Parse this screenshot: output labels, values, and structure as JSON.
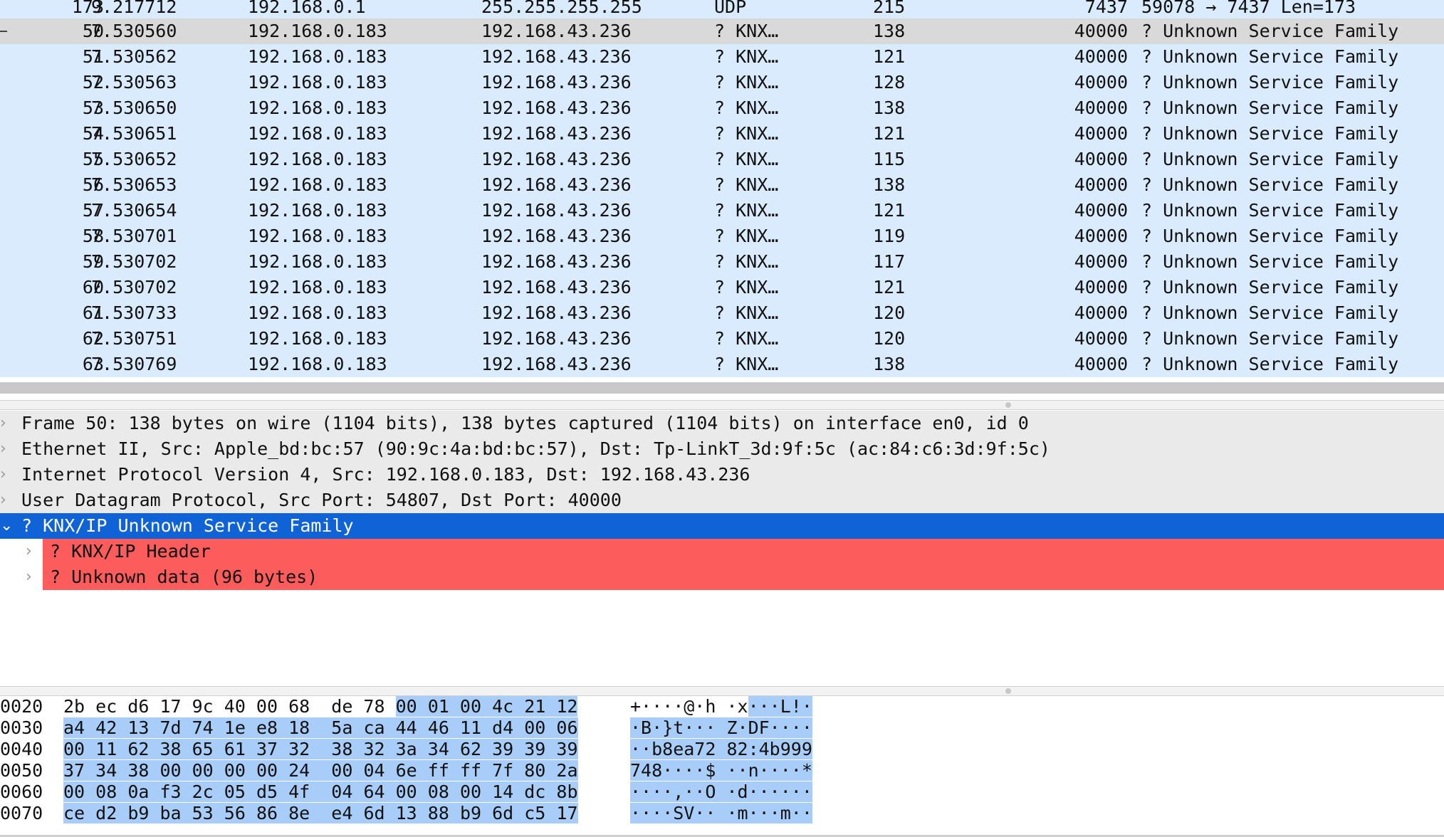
{
  "packets": [
    {
      "no": "173",
      "time": "9.217712",
      "src": "192.168.0.1",
      "dst": "255.255.255.255",
      "proto": "UDP",
      "len": "215",
      "port": "7437",
      "info": "59078 → 7437 Len=173"
    },
    {
      "no": "50",
      "time": "7.530560",
      "src": "192.168.0.183",
      "dst": "192.168.43.236",
      "proto": "? KNX…",
      "len": "138",
      "port": "40000",
      "info": "? Unknown Service Family",
      "selected": true
    },
    {
      "no": "51",
      "time": "7.530562",
      "src": "192.168.0.183",
      "dst": "192.168.43.236",
      "proto": "? KNX…",
      "len": "121",
      "port": "40000",
      "info": "? Unknown Service Family"
    },
    {
      "no": "52",
      "time": "7.530563",
      "src": "192.168.0.183",
      "dst": "192.168.43.236",
      "proto": "? KNX…",
      "len": "128",
      "port": "40000",
      "info": "? Unknown Service Family"
    },
    {
      "no": "53",
      "time": "7.530650",
      "src": "192.168.0.183",
      "dst": "192.168.43.236",
      "proto": "? KNX…",
      "len": "138",
      "port": "40000",
      "info": "? Unknown Service Family"
    },
    {
      "no": "54",
      "time": "7.530651",
      "src": "192.168.0.183",
      "dst": "192.168.43.236",
      "proto": "? KNX…",
      "len": "121",
      "port": "40000",
      "info": "? Unknown Service Family"
    },
    {
      "no": "55",
      "time": "7.530652",
      "src": "192.168.0.183",
      "dst": "192.168.43.236",
      "proto": "? KNX…",
      "len": "115",
      "port": "40000",
      "info": "? Unknown Service Family"
    },
    {
      "no": "56",
      "time": "7.530653",
      "src": "192.168.0.183",
      "dst": "192.168.43.236",
      "proto": "? KNX…",
      "len": "138",
      "port": "40000",
      "info": "? Unknown Service Family"
    },
    {
      "no": "57",
      "time": "7.530654",
      "src": "192.168.0.183",
      "dst": "192.168.43.236",
      "proto": "? KNX…",
      "len": "121",
      "port": "40000",
      "info": "? Unknown Service Family"
    },
    {
      "no": "58",
      "time": "7.530701",
      "src": "192.168.0.183",
      "dst": "192.168.43.236",
      "proto": "? KNX…",
      "len": "119",
      "port": "40000",
      "info": "? Unknown Service Family"
    },
    {
      "no": "59",
      "time": "7.530702",
      "src": "192.168.0.183",
      "dst": "192.168.43.236",
      "proto": "? KNX…",
      "len": "117",
      "port": "40000",
      "info": "? Unknown Service Family"
    },
    {
      "no": "60",
      "time": "7.530702",
      "src": "192.168.0.183",
      "dst": "192.168.43.236",
      "proto": "? KNX…",
      "len": "121",
      "port": "40000",
      "info": "? Unknown Service Family"
    },
    {
      "no": "61",
      "time": "7.530733",
      "src": "192.168.0.183",
      "dst": "192.168.43.236",
      "proto": "? KNX…",
      "len": "120",
      "port": "40000",
      "info": "? Unknown Service Family"
    },
    {
      "no": "62",
      "time": "7.530751",
      "src": "192.168.0.183",
      "dst": "192.168.43.236",
      "proto": "? KNX…",
      "len": "120",
      "port": "40000",
      "info": "? Unknown Service Family"
    },
    {
      "no": "63",
      "time": "7.530769",
      "src": "192.168.0.183",
      "dst": "192.168.43.236",
      "proto": "? KNX…",
      "len": "138",
      "port": "40000",
      "info": "? Unknown Service Family"
    }
  ],
  "details": [
    {
      "text": "Frame 50: 138 bytes on wire (1104 bits), 138 bytes captured (1104 bits) on interface en0, id 0",
      "chevron": "›",
      "level": 0
    },
    {
      "text": "Ethernet II, Src: Apple_bd:bc:57 (90:9c:4a:bd:bc:57), Dst: Tp-LinkT_3d:9f:5c (ac:84:c6:3d:9f:5c)",
      "chevron": "›",
      "level": 0
    },
    {
      "text": "Internet Protocol Version 4, Src: 192.168.0.183, Dst: 192.168.43.236",
      "chevron": "›",
      "level": 0
    },
    {
      "text": "User Datagram Protocol, Src Port: 54807, Dst Port: 40000",
      "chevron": "›",
      "level": 0
    },
    {
      "text": "? KNX/IP Unknown Service Family",
      "chevron": "⌄",
      "level": 0,
      "selected": true
    },
    {
      "text": "? KNX/IP Header",
      "chevron": "›",
      "level": 1,
      "error": true
    },
    {
      "text": "? Unknown data (96 bytes)",
      "chevron": "›",
      "level": 1,
      "error": true
    }
  ],
  "hex": [
    {
      "offset": "0020",
      "bytes": [
        "2b",
        "ec",
        "d6",
        "17",
        "9c",
        "40",
        "00",
        "68",
        "de",
        "78",
        "00",
        "01",
        "00",
        "4c",
        "21",
        "12"
      ],
      "ascii": "+····@·h ·x···L!·",
      "hl_from": 10
    },
    {
      "offset": "0030",
      "bytes": [
        "a4",
        "42",
        "13",
        "7d",
        "74",
        "1e",
        "e8",
        "18",
        "5a",
        "ca",
        "44",
        "46",
        "11",
        "d4",
        "00",
        "06"
      ],
      "ascii": "·B·}t··· Z·DF····",
      "hl_from": 0
    },
    {
      "offset": "0040",
      "bytes": [
        "00",
        "11",
        "62",
        "38",
        "65",
        "61",
        "37",
        "32",
        "38",
        "32",
        "3a",
        "34",
        "62",
        "39",
        "39",
        "39"
      ],
      "ascii": "··b8ea72 82:4b999",
      "hl_from": 0
    },
    {
      "offset": "0050",
      "bytes": [
        "37",
        "34",
        "38",
        "00",
        "00",
        "00",
        "00",
        "24",
        "00",
        "04",
        "6e",
        "ff",
        "ff",
        "7f",
        "80",
        "2a"
      ],
      "ascii": "748····$ ··n····*",
      "hl_from": 0
    },
    {
      "offset": "0060",
      "bytes": [
        "00",
        "08",
        "0a",
        "f3",
        "2c",
        "05",
        "d5",
        "4f",
        "04",
        "64",
        "00",
        "08",
        "00",
        "14",
        "dc",
        "8b"
      ],
      "ascii": "····,··O ·d······",
      "hl_from": 0
    },
    {
      "offset": "0070",
      "bytes": [
        "ce",
        "d2",
        "b9",
        "ba",
        "53",
        "56",
        "86",
        "8e",
        "e4",
        "6d",
        "13",
        "88",
        "b9",
        "6d",
        "c5",
        "17"
      ],
      "ascii": "····SV·· ·m···m··",
      "hl_from": 0
    }
  ],
  "colors": {
    "row_bg": "#d9ebfd",
    "selected_row_bg": "#d9d9d9",
    "tree_selected": "#0f63d6",
    "tree_error": "#fd5c5c",
    "hex_highlight": "#a8cdf8"
  }
}
